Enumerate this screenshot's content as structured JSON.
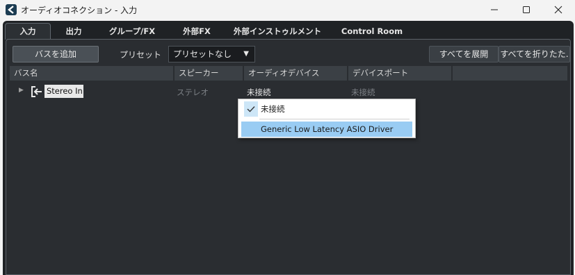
{
  "window": {
    "title": "オーディオコネクション - 入力",
    "minimize_icon": "minimize-icon",
    "maximize_icon": "maximize-icon",
    "close_icon": "close-icon"
  },
  "tabs": [
    {
      "label": "入力",
      "active": true
    },
    {
      "label": "出力"
    },
    {
      "label": "グループ/FX"
    },
    {
      "label": "外部FX"
    },
    {
      "label": "外部インストゥルメント"
    },
    {
      "label": "Control Room"
    }
  ],
  "toolbar": {
    "add_bus_label": "バスを追加",
    "preset_label": "プリセット",
    "preset_value": "プリセットなし",
    "expand_all_label": "すべてを展開",
    "collapse_all_label": "すべてを折りたた."
  },
  "columns": [
    "バス名",
    "スピーカー",
    "オーディオデバイス",
    "デバイスポート",
    ""
  ],
  "rows": [
    {
      "name": "Stereo In",
      "speaker": "ステレオ",
      "device": "未接続",
      "port": "未接続"
    }
  ],
  "device_dropdown": {
    "options": [
      {
        "label": "未接続",
        "checked": true
      },
      {
        "label": "Generic Low Latency ASIO Driver",
        "highlighted": true
      }
    ]
  },
  "colors": {
    "background": "#1f2225",
    "panel": "#2a2d31",
    "header": "#3b4045",
    "highlight": "#99ccf3"
  }
}
